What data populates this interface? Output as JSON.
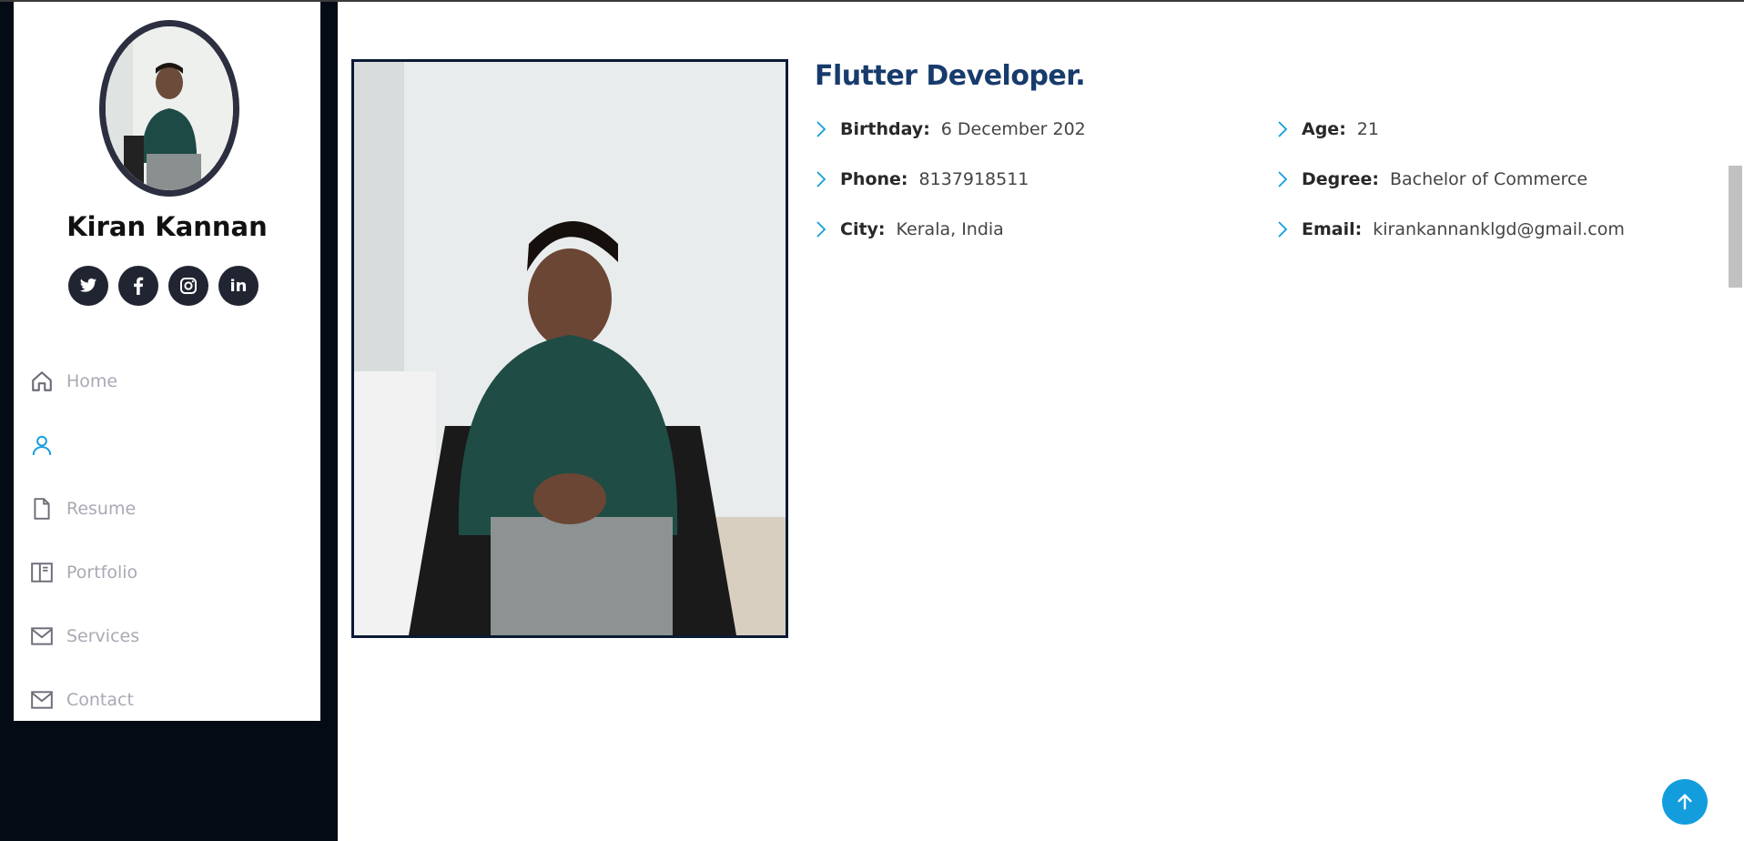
{
  "profile": {
    "name": "Kiran Kannan"
  },
  "social": [
    {
      "icon": "twitter-icon"
    },
    {
      "icon": "facebook-icon"
    },
    {
      "icon": "instagram-icon"
    },
    {
      "icon": "linkedin-icon",
      "text": "in"
    }
  ],
  "nav": {
    "items": [
      {
        "label": "Home",
        "icon": "home-icon"
      },
      {
        "label": "",
        "icon": "user-icon",
        "active": true
      },
      {
        "label": "Resume",
        "icon": "file-icon"
      },
      {
        "label": "Portfolio",
        "icon": "book-icon"
      },
      {
        "label": "Services",
        "icon": "envelope-icon"
      },
      {
        "label": "Contact",
        "icon": "envelope-icon"
      }
    ]
  },
  "about": {
    "role": "Flutter Developer.",
    "rows": [
      [
        {
          "label": "Birthday:",
          "value": "6 December 202"
        },
        {
          "label": "Age:",
          "value": "21"
        }
      ],
      [
        {
          "label": "Phone:",
          "value": "8137918511"
        },
        {
          "label": "Degree:",
          "value": "Bachelor of Commerce"
        }
      ],
      [
        {
          "label": "City:",
          "value": "Kerala, India"
        },
        {
          "label": "Email:",
          "value": "kirankannanklgd@gmail.com"
        }
      ]
    ]
  },
  "colors": {
    "accent": "#149ddd",
    "sidebar_dark": "#040b14",
    "heading": "#173b6c",
    "social_bg": "#212431"
  }
}
